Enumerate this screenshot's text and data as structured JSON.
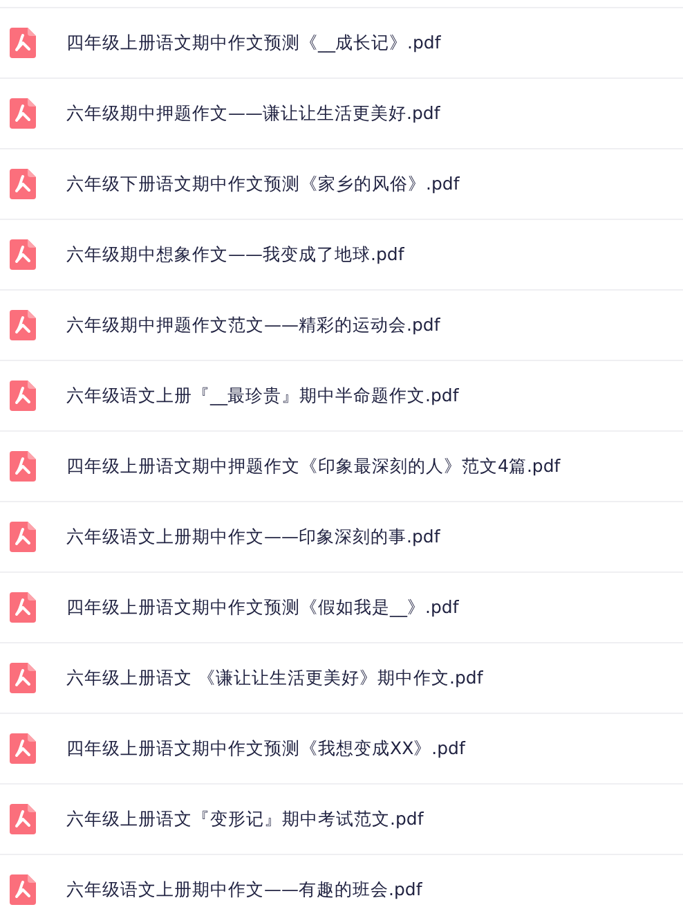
{
  "files": [
    {
      "name": "四年级上册语文期中作文预测《__成长记》.pdf"
    },
    {
      "name": "六年级期中押题作文——谦让让生活更美好.pdf"
    },
    {
      "name": "六年级下册语文期中作文预测《家乡的风俗》.pdf"
    },
    {
      "name": "六年级期中想象作文——我变成了地球.pdf"
    },
    {
      "name": "六年级期中押题作文范文——精彩的运动会.pdf"
    },
    {
      "name": "六年级语文上册『__最珍贵』期中半命题作文.pdf"
    },
    {
      "name": "四年级上册语文期中押题作文《印象最深刻的人》范文4篇.pdf"
    },
    {
      "name": "六年级语文上册期中作文——印象深刻的事.pdf"
    },
    {
      "name": "四年级上册语文期中作文预测《假如我是__》.pdf"
    },
    {
      "name": "六年级上册语文 《谦让让生活更美好》期中作文.pdf"
    },
    {
      "name": "四年级上册语文期中作文预测《我想变成XX》.pdf"
    },
    {
      "name": "六年级上册语文『变形记』期中考试范文.pdf"
    },
    {
      "name": "六年级语文上册期中作文——有趣的班会.pdf"
    }
  ]
}
